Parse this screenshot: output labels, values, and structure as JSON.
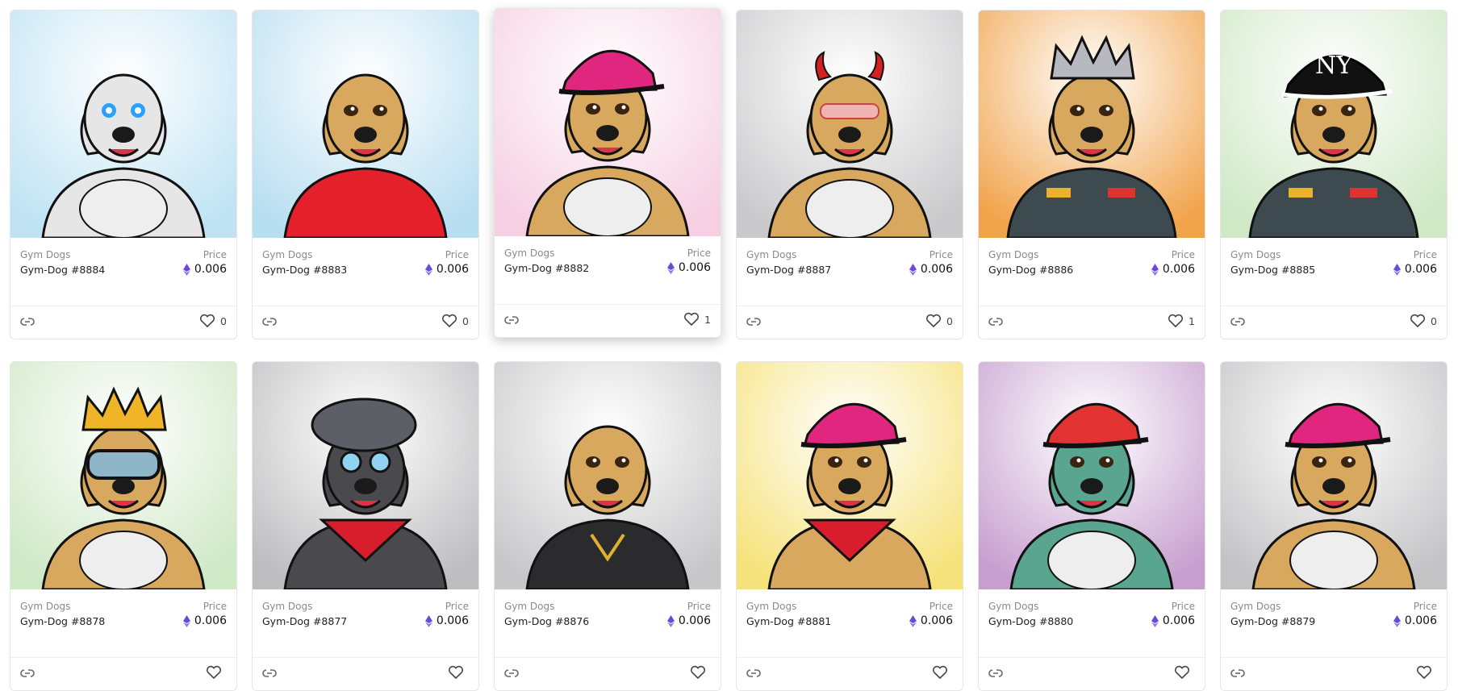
{
  "cards": [
    {
      "collection": "Gym Dogs",
      "name": "Gym-Dog #8884",
      "price_label": "Price",
      "price": "0.006",
      "likes": "0",
      "bg": "#bfe3f3",
      "fur": "#e6e6e6",
      "accessory": "glowing-eyes"
    },
    {
      "collection": "Gym Dogs",
      "name": "Gym-Dog #8883",
      "price_label": "Price",
      "price": "0.006",
      "likes": "0",
      "bg": "#b8def1",
      "fur": "#d8a85e",
      "accessory": "red-hoodie"
    },
    {
      "collection": "Gym Dogs",
      "name": "Gym-Dog #8882",
      "price_label": "Price",
      "price": "0.006",
      "likes": "1",
      "bg": "#f6cfe2",
      "fur": "#d8a85e",
      "accessory": "pink-cap-rifle"
    },
    {
      "collection": "Gym Dogs",
      "name": "Gym-Dog #8887",
      "price_label": "Price",
      "price": "0.006",
      "likes": "0",
      "bg": "#c9c9cb",
      "fur": "#d8a85e",
      "accessory": "devil-horns"
    },
    {
      "collection": "Gym Dogs",
      "name": "Gym-Dog #8886",
      "price_label": "Price",
      "price": "0.006",
      "likes": "1",
      "bg": "#f1a34a",
      "fur": "#d8a85e",
      "accessory": "crown-uniform"
    },
    {
      "collection": "Gym Dogs",
      "name": "Gym-Dog #8885",
      "price_label": "Price",
      "price": "0.006",
      "likes": "0",
      "bg": "#cfe8c6",
      "fur": "#d8a85e",
      "accessory": "ny-cap-uniform"
    },
    {
      "collection": "Gym Dogs",
      "name": "Gym-Dog #8878",
      "price_label": "Price",
      "price": "0.006",
      "likes": "",
      "bg": "#cfe8c6",
      "fur": "#d8a85e",
      "accessory": "crown-goggles"
    },
    {
      "collection": "Gym Dogs",
      "name": "Gym-Dog #8877",
      "price_label": "Price",
      "price": "0.006",
      "likes": "",
      "bg": "#bdbdbf",
      "fur": "#4a4a4e",
      "accessory": "beret-bandana"
    },
    {
      "collection": "Gym Dogs",
      "name": "Gym-Dog #8876",
      "price_label": "Price",
      "price": "0.006",
      "likes": "",
      "bg": "#c7c7c9",
      "fur": "#d8a85e",
      "accessory": "black-hoodie"
    },
    {
      "collection": "Gym Dogs",
      "name": "Gym-Dog #8881",
      "price_label": "Price",
      "price": "0.006",
      "likes": "",
      "bg": "#f6e27a",
      "fur": "#d8a85e",
      "accessory": "pink-cap-bandana"
    },
    {
      "collection": "Gym Dogs",
      "name": "Gym-Dog #8880",
      "price_label": "Price",
      "price": "0.006",
      "likes": "",
      "bg": "#c79fcf",
      "fur": "#5aa58f",
      "accessory": "zombie-red-cap"
    },
    {
      "collection": "Gym Dogs",
      "name": "Gym-Dog #8879",
      "price_label": "Price",
      "price": "0.006",
      "likes": "",
      "bg": "#c3c3c5",
      "fur": "#d8a85e",
      "accessory": "pink-cap"
    }
  ],
  "colors": {
    "eth": "#6b4bd6",
    "border": "#e6e6e6"
  }
}
